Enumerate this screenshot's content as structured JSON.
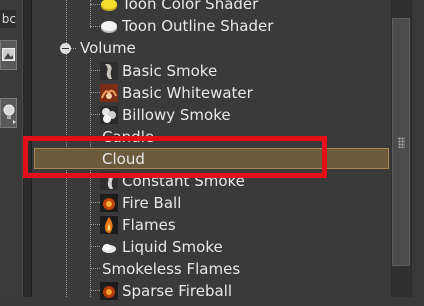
{
  "sidebar": {
    "top_label": "bc"
  },
  "tree": {
    "items": [
      {
        "label": "Toon Color Shader",
        "icon": "yellow-disc-icon"
      },
      {
        "label": "Toon Outline Shader",
        "icon": "white-disc-icon"
      },
      {
        "label": "Volume",
        "icon": "collapse-icon"
      },
      {
        "label": "Basic Smoke",
        "icon": "smoke-icon"
      },
      {
        "label": "Basic Whitewater",
        "icon": "whitewater-icon"
      },
      {
        "label": "Billowy Smoke",
        "icon": "billowy-smoke-icon"
      },
      {
        "label": "Candle",
        "icon": ""
      },
      {
        "label": "Cloud",
        "icon": ""
      },
      {
        "label": "Constant Smoke",
        "icon": "smoke-icon"
      },
      {
        "label": "Fire Ball",
        "icon": "fireball-icon"
      },
      {
        "label": "Flames",
        "icon": "flame-icon"
      },
      {
        "label": "Liquid Smoke",
        "icon": "liquid-smoke-icon"
      },
      {
        "label": "Smokeless Flames",
        "icon": ""
      },
      {
        "label": "Sparse Fireball",
        "icon": "fireball-icon"
      }
    ],
    "selected": "Cloud"
  },
  "colors": {
    "selection_fill": "#6b5a3c",
    "annotation_box": "#e3101a"
  }
}
